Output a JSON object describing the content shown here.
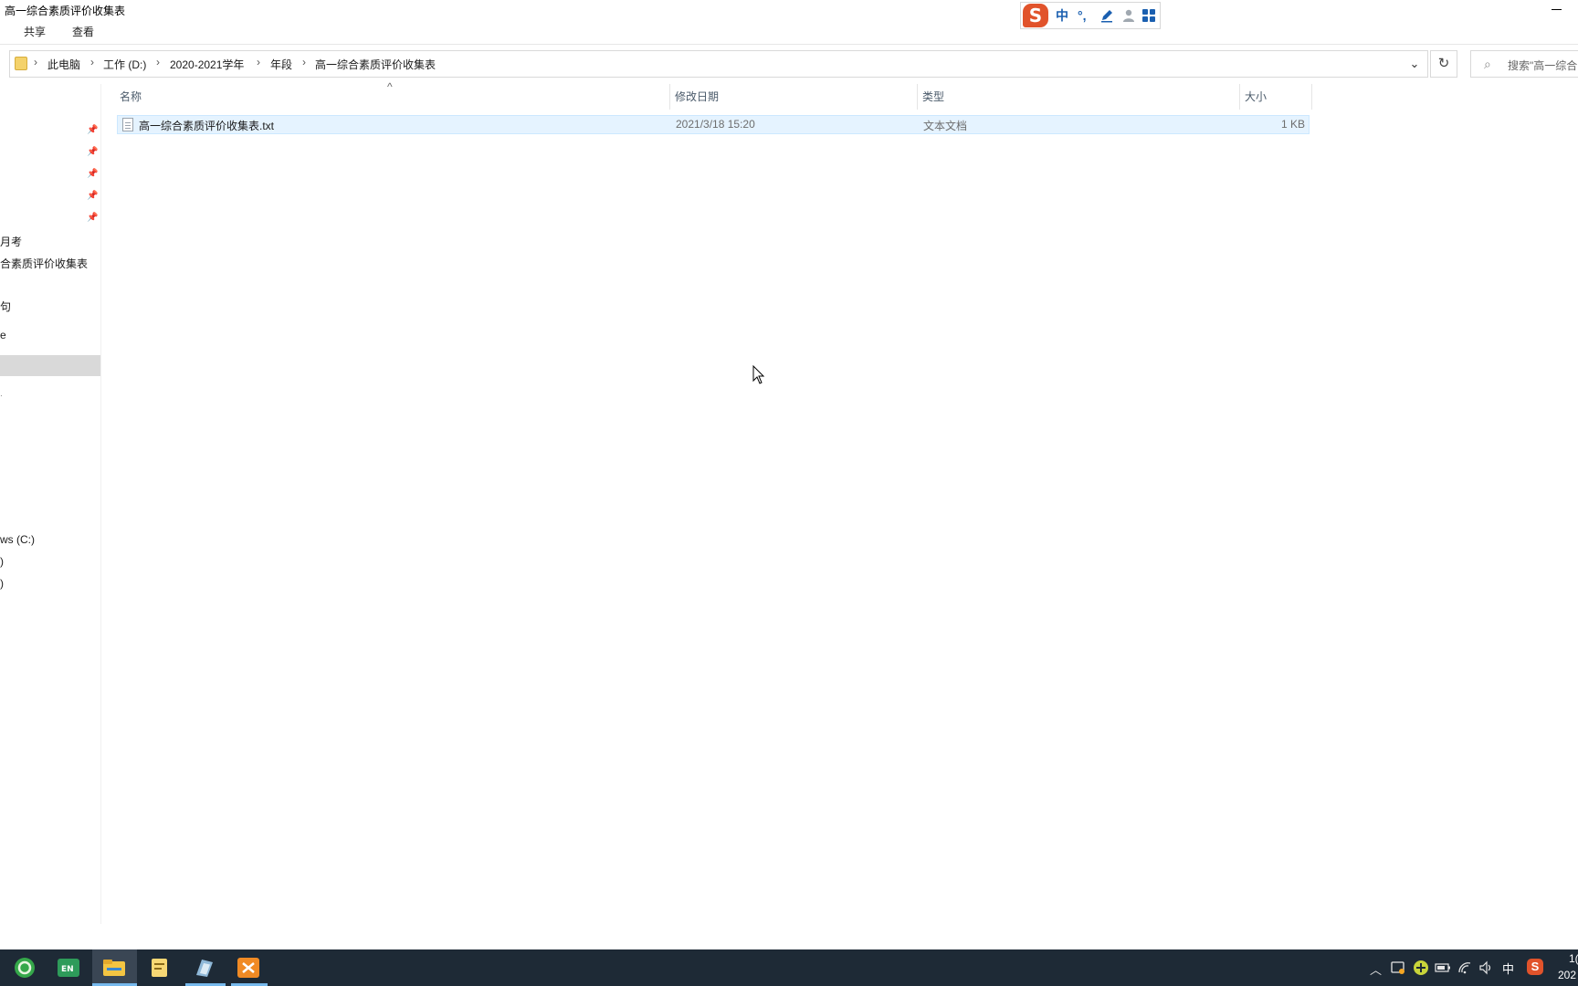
{
  "window": {
    "title": "高一综合素质评价收集表"
  },
  "ribbon": {
    "tabs": [
      {
        "label": "共享"
      },
      {
        "label": "查看"
      }
    ]
  },
  "ime_bar": {
    "logo": "S",
    "mode": "中",
    "punct": "°,",
    "icons": [
      "pen-icon",
      "user-icon",
      "grid-icon"
    ]
  },
  "address": {
    "crumbs": [
      {
        "label": "此电脑"
      },
      {
        "label": "工作 (D:)"
      },
      {
        "label": "2020-2021学年"
      },
      {
        "label": "年段"
      },
      {
        "label": "高一综合素质评价收集表"
      }
    ],
    "separator": "›",
    "dropdown_icon": "⌄",
    "refresh_icon": "↻"
  },
  "search": {
    "placeholder": "搜索\"高一综合",
    "icon": "⌕"
  },
  "columns": {
    "name": "名称",
    "date": "修改日期",
    "type": "类型",
    "size": "大小"
  },
  "files": [
    {
      "name": "高一综合素质评价收集表.txt",
      "date": "2021/3/18 15:20",
      "type": "文本文档",
      "size": "1 KB"
    }
  ],
  "nav": {
    "pin_icon": "📌",
    "items": [
      {
        "label": "月考"
      },
      {
        "label": "合素质评价收集表"
      },
      {
        "label": "句"
      },
      {
        "label": "e"
      },
      {
        "label": "ws (C:)"
      },
      {
        "label": ")"
      },
      {
        "label": ")"
      }
    ]
  },
  "taskbar": {
    "ime_label": "中",
    "sogou_label": "S",
    "clock_time": "1(",
    "clock_date": "202"
  }
}
